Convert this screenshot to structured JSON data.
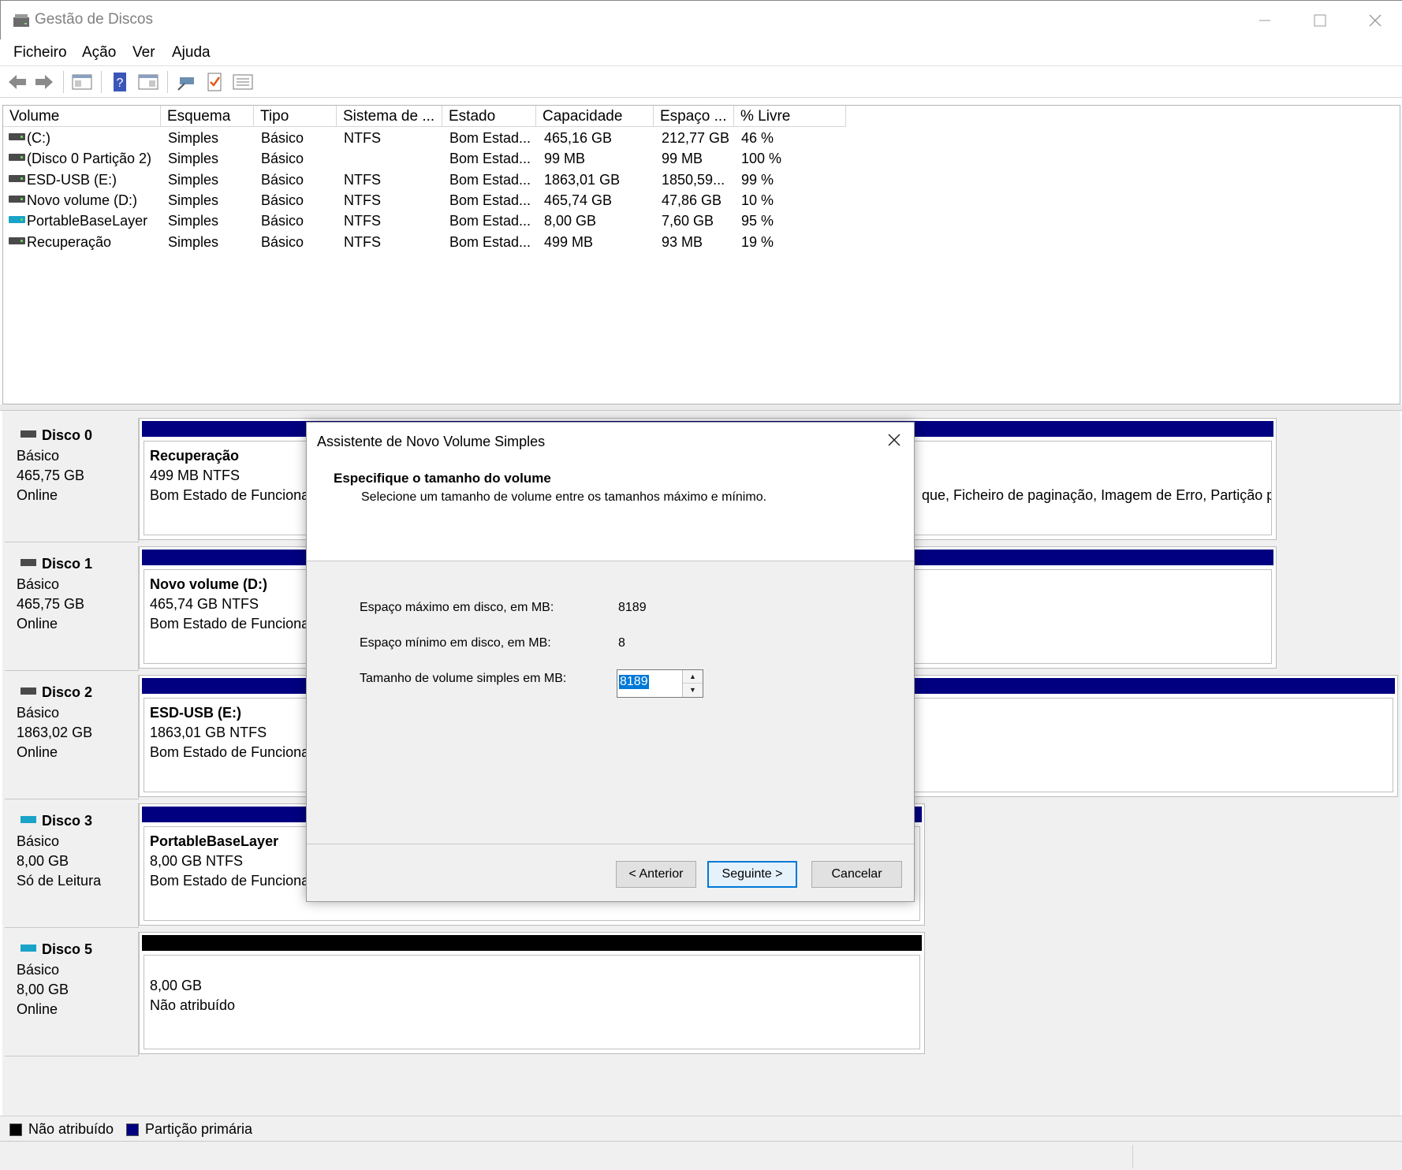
{
  "window": {
    "title": "Gestão de Discos",
    "controls": [
      "minimize",
      "maximize",
      "close"
    ]
  },
  "menu": [
    "Ficheiro",
    "Ação",
    "Ver",
    "Ajuda"
  ],
  "toolbar_icons": [
    "back-icon",
    "forward-icon",
    "console-tree-icon",
    "help-icon",
    "properties-icon",
    "connect-icon",
    "check-icon",
    "list-icon"
  ],
  "volume_table": {
    "headers": [
      "Volume",
      "Esquema",
      "Tipo",
      "Sistema de ...",
      "Estado",
      "Capacidade",
      "Espaço ...",
      "% Livre"
    ],
    "rows": [
      [
        "(C:)",
        "Simples",
        "Básico",
        "NTFS",
        "Bom Estad...",
        "465,16 GB",
        "212,77 GB",
        "46 %"
      ],
      [
        "(Disco 0 Partição 2)",
        "Simples",
        "Básico",
        "",
        "Bom Estad...",
        "99 MB",
        "99 MB",
        "100 %"
      ],
      [
        "ESD-USB (E:)",
        "Simples",
        "Básico",
        "NTFS",
        "Bom Estad...",
        "1863,01 GB",
        "1850,59...",
        "99 %"
      ],
      [
        "Novo volume (D:)",
        "Simples",
        "Básico",
        "NTFS",
        "Bom Estad...",
        "465,74 GB",
        "47,86 GB",
        "10 %"
      ],
      [
        "PortableBaseLayer",
        "Simples",
        "Básico",
        "NTFS",
        "Bom Estad...",
        "8,00 GB",
        "7,60 GB",
        "95 %"
      ],
      [
        "Recuperação",
        "Simples",
        "Básico",
        "NTFS",
        "Bom Estad...",
        "499 MB",
        "93 MB",
        "19 %"
      ]
    ]
  },
  "disks": [
    {
      "name": "Disco 0",
      "type": "Básico",
      "size": "465,75 GB",
      "status": "Online",
      "partition": {
        "name": "Recuperação",
        "size": "499 MB NTFS",
        "state": "Bom Estado de Funciona"
      },
      "right_text": "que, Ficheiro de paginação, Imagem de Erro, Partição p"
    },
    {
      "name": "Disco 1",
      "type": "Básico",
      "size": "465,75 GB",
      "status": "Online",
      "partition": {
        "name": "Novo volume  (D:)",
        "size": "465,74 GB NTFS",
        "state": "Bom Estado de Funciona"
      }
    },
    {
      "name": "Disco 2",
      "type": "Básico",
      "size": "1863,02 GB",
      "status": "Online",
      "partition": {
        "name": "ESD-USB  (E:)",
        "size": "1863,01 GB NTFS",
        "state": "Bom Estado de Funciona"
      }
    },
    {
      "name": "Disco 3",
      "type": "Básico",
      "size": "8,00 GB",
      "status": "Só de Leitura",
      "partition": {
        "name": "PortableBaseLayer",
        "size": "8,00 GB NTFS",
        "state": "Bom Estado de Funciona"
      }
    },
    {
      "name": "Disco 5",
      "type": "Básico",
      "size": "8,00 GB",
      "status": "Online",
      "partition": {
        "size": "8,00 GB",
        "state": "Não atribuído"
      }
    }
  ],
  "legend": [
    "Não atribuído",
    "Partição primária"
  ],
  "dialog": {
    "title": "Assistente de Novo Volume Simples",
    "heading": "Especifique o tamanho do volume",
    "subheading": "Selecione um tamanho de volume entre os tamanhos máximo e mínimo.",
    "max_label": "Espaço máximo em disco, em MB:",
    "max_value": "8189",
    "min_label": "Espaço mínimo em disco, em MB:",
    "min_value": "8",
    "size_label": "Tamanho de volume simples em MB:",
    "size_value": "8189",
    "buttons": {
      "back": "< Anterior",
      "next": "Seguinte >",
      "cancel": "Cancelar"
    }
  },
  "colors": {
    "primary_partition": "#000080",
    "unallocated": "#000000",
    "selection": "#0078d7"
  }
}
